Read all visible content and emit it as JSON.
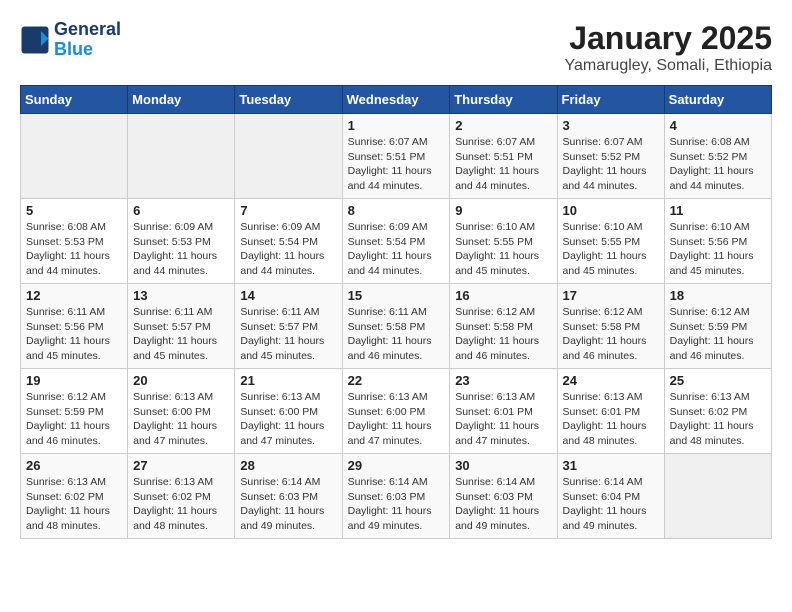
{
  "logo": {
    "line1": "General",
    "line2": "Blue"
  },
  "title": "January 2025",
  "subtitle": "Yamarugley, Somali, Ethiopia",
  "days_of_week": [
    "Sunday",
    "Monday",
    "Tuesday",
    "Wednesday",
    "Thursday",
    "Friday",
    "Saturday"
  ],
  "weeks": [
    [
      {
        "day": "",
        "info": ""
      },
      {
        "day": "",
        "info": ""
      },
      {
        "day": "",
        "info": ""
      },
      {
        "day": "1",
        "info": "Sunrise: 6:07 AM\nSunset: 5:51 PM\nDaylight: 11 hours and 44 minutes."
      },
      {
        "day": "2",
        "info": "Sunrise: 6:07 AM\nSunset: 5:51 PM\nDaylight: 11 hours and 44 minutes."
      },
      {
        "day": "3",
        "info": "Sunrise: 6:07 AM\nSunset: 5:52 PM\nDaylight: 11 hours and 44 minutes."
      },
      {
        "day": "4",
        "info": "Sunrise: 6:08 AM\nSunset: 5:52 PM\nDaylight: 11 hours and 44 minutes."
      }
    ],
    [
      {
        "day": "5",
        "info": "Sunrise: 6:08 AM\nSunset: 5:53 PM\nDaylight: 11 hours and 44 minutes."
      },
      {
        "day": "6",
        "info": "Sunrise: 6:09 AM\nSunset: 5:53 PM\nDaylight: 11 hours and 44 minutes."
      },
      {
        "day": "7",
        "info": "Sunrise: 6:09 AM\nSunset: 5:54 PM\nDaylight: 11 hours and 44 minutes."
      },
      {
        "day": "8",
        "info": "Sunrise: 6:09 AM\nSunset: 5:54 PM\nDaylight: 11 hours and 44 minutes."
      },
      {
        "day": "9",
        "info": "Sunrise: 6:10 AM\nSunset: 5:55 PM\nDaylight: 11 hours and 45 minutes."
      },
      {
        "day": "10",
        "info": "Sunrise: 6:10 AM\nSunset: 5:55 PM\nDaylight: 11 hours and 45 minutes."
      },
      {
        "day": "11",
        "info": "Sunrise: 6:10 AM\nSunset: 5:56 PM\nDaylight: 11 hours and 45 minutes."
      }
    ],
    [
      {
        "day": "12",
        "info": "Sunrise: 6:11 AM\nSunset: 5:56 PM\nDaylight: 11 hours and 45 minutes."
      },
      {
        "day": "13",
        "info": "Sunrise: 6:11 AM\nSunset: 5:57 PM\nDaylight: 11 hours and 45 minutes."
      },
      {
        "day": "14",
        "info": "Sunrise: 6:11 AM\nSunset: 5:57 PM\nDaylight: 11 hours and 45 minutes."
      },
      {
        "day": "15",
        "info": "Sunrise: 6:11 AM\nSunset: 5:58 PM\nDaylight: 11 hours and 46 minutes."
      },
      {
        "day": "16",
        "info": "Sunrise: 6:12 AM\nSunset: 5:58 PM\nDaylight: 11 hours and 46 minutes."
      },
      {
        "day": "17",
        "info": "Sunrise: 6:12 AM\nSunset: 5:58 PM\nDaylight: 11 hours and 46 minutes."
      },
      {
        "day": "18",
        "info": "Sunrise: 6:12 AM\nSunset: 5:59 PM\nDaylight: 11 hours and 46 minutes."
      }
    ],
    [
      {
        "day": "19",
        "info": "Sunrise: 6:12 AM\nSunset: 5:59 PM\nDaylight: 11 hours and 46 minutes."
      },
      {
        "day": "20",
        "info": "Sunrise: 6:13 AM\nSunset: 6:00 PM\nDaylight: 11 hours and 47 minutes."
      },
      {
        "day": "21",
        "info": "Sunrise: 6:13 AM\nSunset: 6:00 PM\nDaylight: 11 hours and 47 minutes."
      },
      {
        "day": "22",
        "info": "Sunrise: 6:13 AM\nSunset: 6:00 PM\nDaylight: 11 hours and 47 minutes."
      },
      {
        "day": "23",
        "info": "Sunrise: 6:13 AM\nSunset: 6:01 PM\nDaylight: 11 hours and 47 minutes."
      },
      {
        "day": "24",
        "info": "Sunrise: 6:13 AM\nSunset: 6:01 PM\nDaylight: 11 hours and 48 minutes."
      },
      {
        "day": "25",
        "info": "Sunrise: 6:13 AM\nSunset: 6:02 PM\nDaylight: 11 hours and 48 minutes."
      }
    ],
    [
      {
        "day": "26",
        "info": "Sunrise: 6:13 AM\nSunset: 6:02 PM\nDaylight: 11 hours and 48 minutes."
      },
      {
        "day": "27",
        "info": "Sunrise: 6:13 AM\nSunset: 6:02 PM\nDaylight: 11 hours and 48 minutes."
      },
      {
        "day": "28",
        "info": "Sunrise: 6:14 AM\nSunset: 6:03 PM\nDaylight: 11 hours and 49 minutes."
      },
      {
        "day": "29",
        "info": "Sunrise: 6:14 AM\nSunset: 6:03 PM\nDaylight: 11 hours and 49 minutes."
      },
      {
        "day": "30",
        "info": "Sunrise: 6:14 AM\nSunset: 6:03 PM\nDaylight: 11 hours and 49 minutes."
      },
      {
        "day": "31",
        "info": "Sunrise: 6:14 AM\nSunset: 6:04 PM\nDaylight: 11 hours and 49 minutes."
      },
      {
        "day": "",
        "info": ""
      }
    ]
  ]
}
